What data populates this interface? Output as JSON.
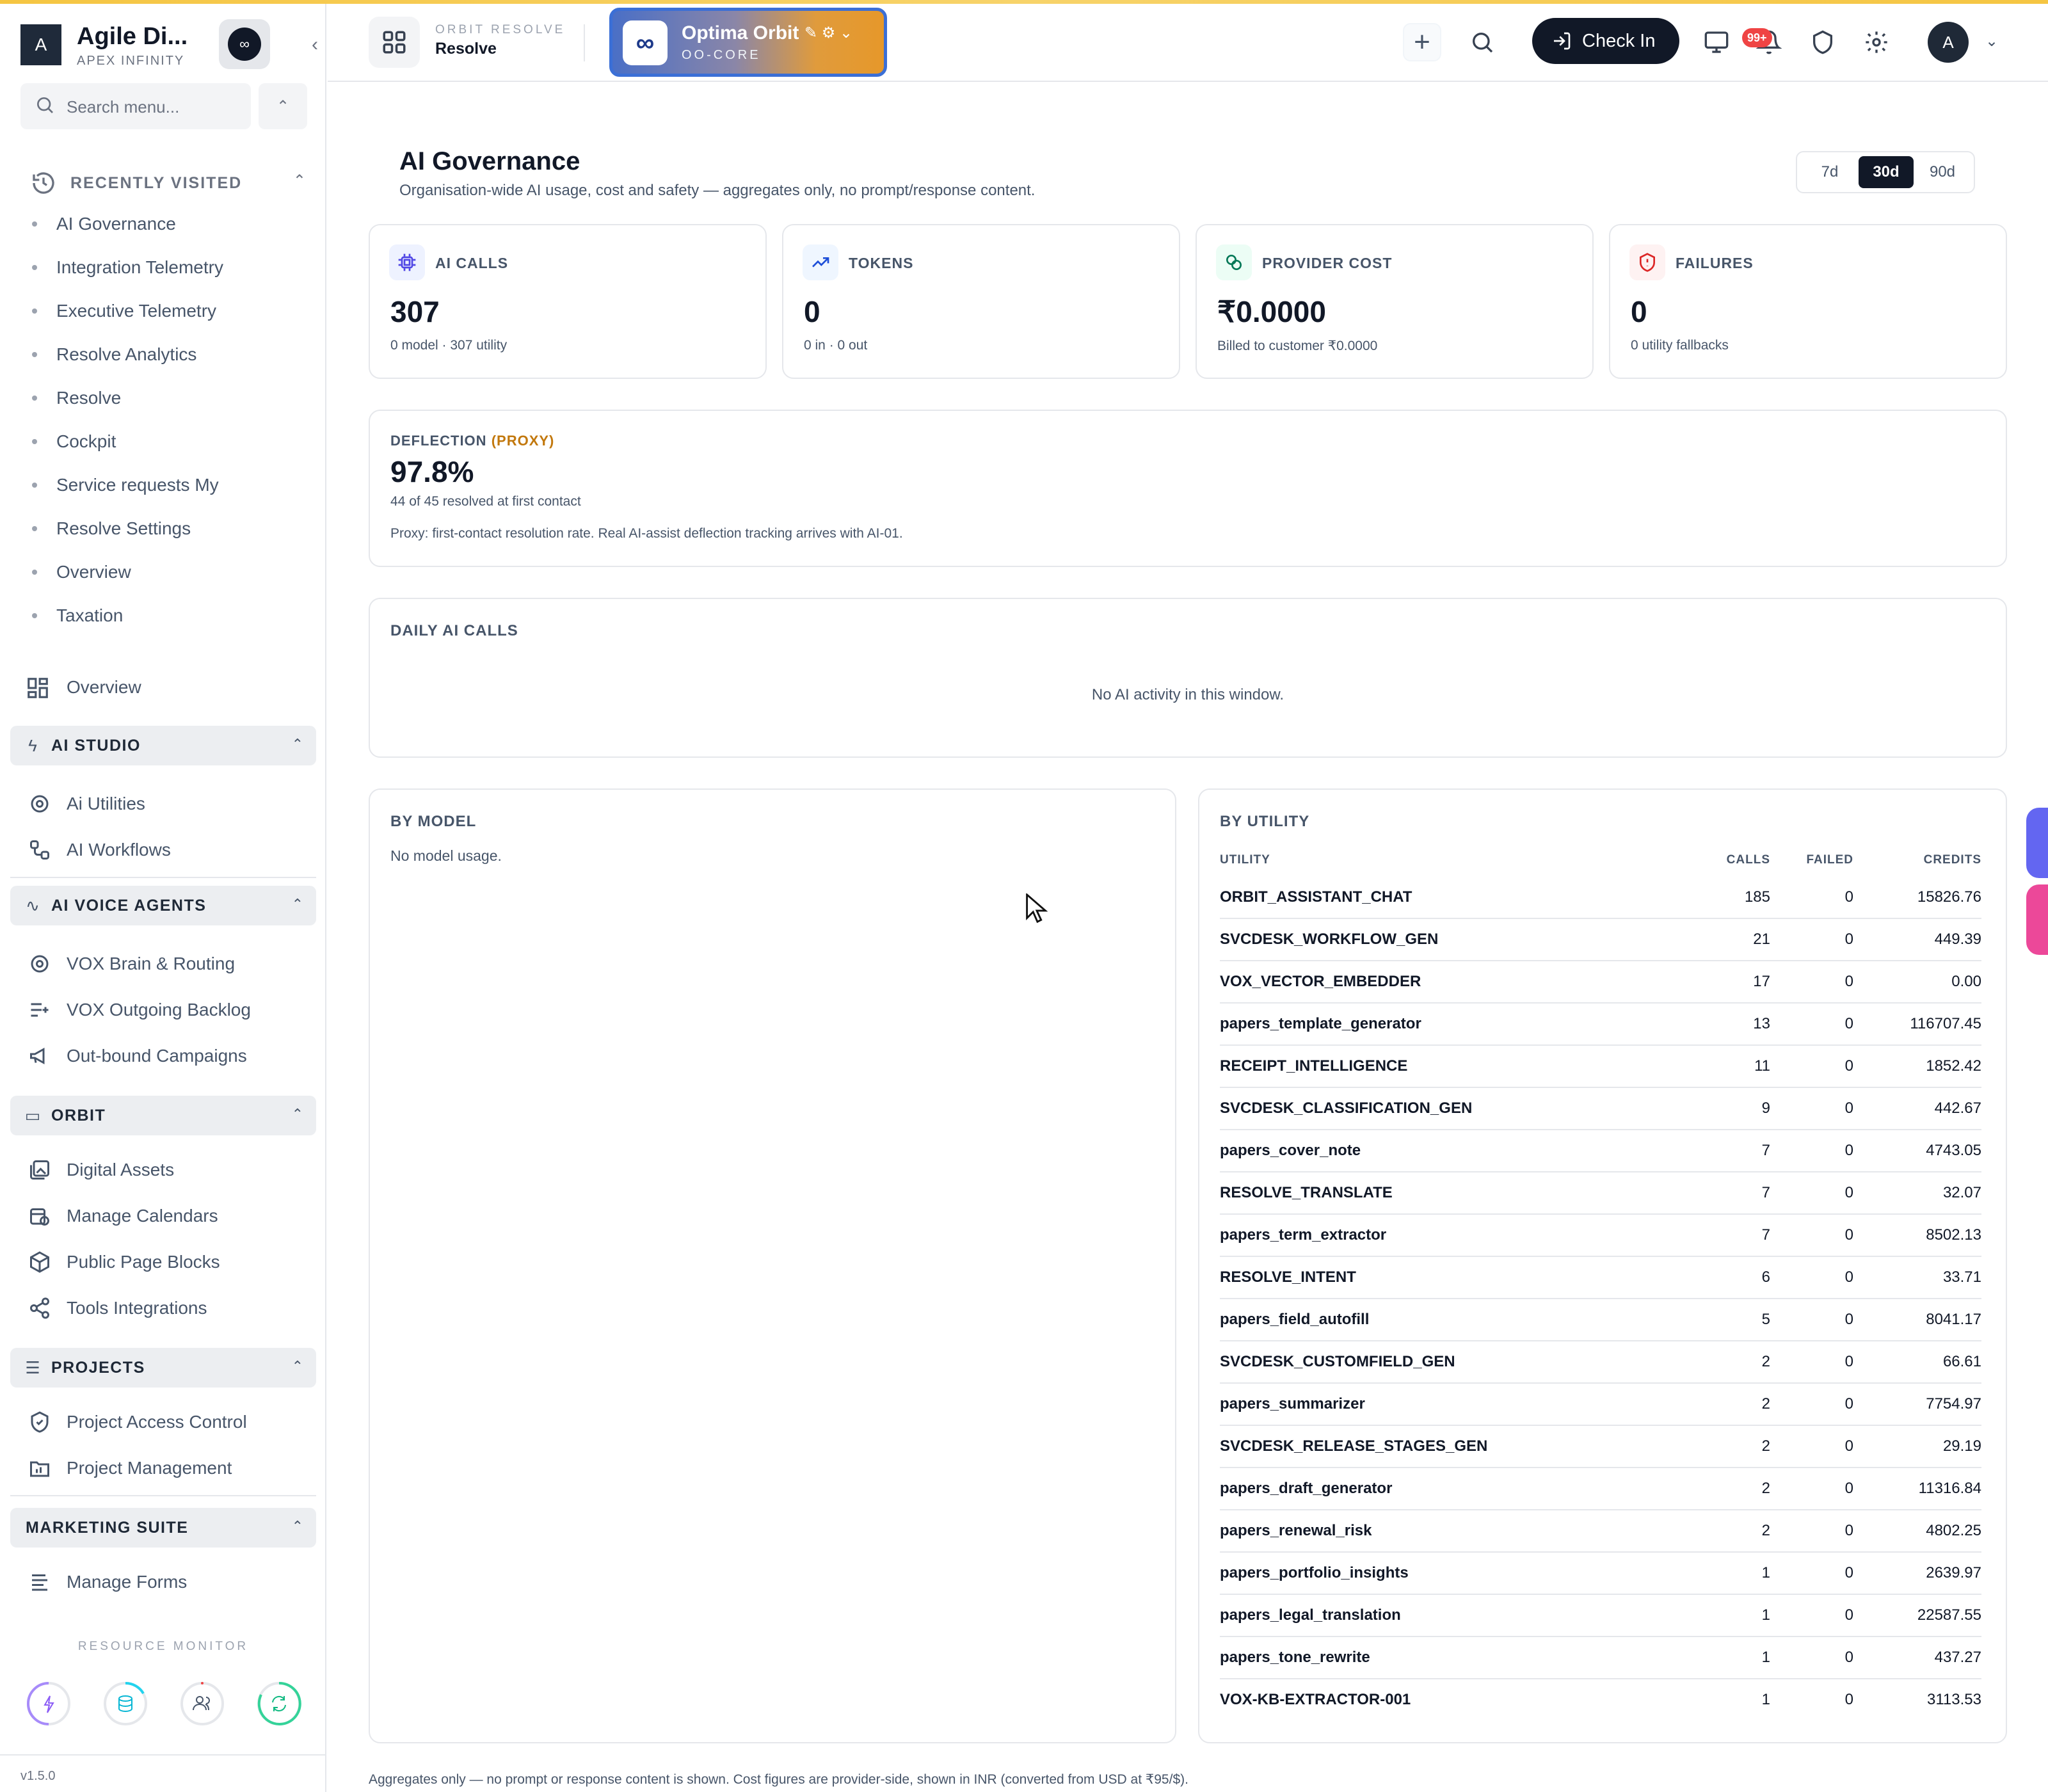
{
  "sidebar": {
    "brand": {
      "initial": "A",
      "name": "Agile Di...",
      "subtitle": "APEX INFINITY"
    },
    "search_placeholder": "Search menu...",
    "recently_visited": {
      "label": "RECENTLY VISITED",
      "items": [
        "AI Governance",
        "Integration Telemetry",
        "Executive Telemetry",
        "Resolve Analytics",
        "Resolve",
        "Cockpit",
        "Service requests My",
        "Resolve Settings",
        "Overview",
        "Taxation"
      ]
    },
    "overview_label": "Overview",
    "sections": [
      {
        "label": "AI STUDIO",
        "items": [
          "Ai Utilities",
          "AI Workflows"
        ]
      },
      {
        "label": "AI VOICE AGENTS",
        "items": [
          "VOX Brain & Routing",
          "VOX Outgoing Backlog",
          "Out-bound Campaigns"
        ]
      },
      {
        "label": "ORBIT",
        "items": [
          "Digital Assets",
          "Manage Calendars",
          "Public Page Blocks",
          "Tools Integrations"
        ]
      },
      {
        "label": "PROJECTS",
        "items": [
          "Project Access Control",
          "Project Management"
        ]
      },
      {
        "label": "MARKETING SUITE",
        "items": [
          "Manage Forms"
        ]
      }
    ],
    "resource_monitor_label": "RESOURCE MONITOR",
    "resource_icons": [
      "bolt-icon",
      "database-icon",
      "users-icon",
      "refresh-icon"
    ],
    "version": "v1.5.0"
  },
  "header": {
    "app_kicker": "ORBIT RESOLVE",
    "app_name": "Resolve",
    "org": {
      "name": "Optima Orbit",
      "code": "OO-CORE"
    },
    "check_in_label": "Check In",
    "notification_badge": "99+",
    "avatar_initial": "A"
  },
  "page": {
    "title": "AI Governance",
    "subtitle": "Organisation-wide AI usage, cost and safety — aggregates only, no prompt/response content.",
    "ranges": [
      "7d",
      "30d",
      "90d"
    ],
    "active_range": "30d"
  },
  "stats": [
    {
      "label": "AI CALLS",
      "value": "307",
      "sub": "0 model · 307 utility",
      "icon": "chip-icon",
      "color": "#eef2ff"
    },
    {
      "label": "TOKENS",
      "value": "0",
      "sub": "0 in · 0 out",
      "icon": "trending-up-icon",
      "color": "#eff6ff"
    },
    {
      "label": "PROVIDER COST",
      "value": "₹0.0000",
      "sub": "Billed to customer ₹0.0000",
      "icon": "coins-icon",
      "color": "#ecfdf5"
    },
    {
      "label": "FAILURES",
      "value": "0",
      "sub": "0 utility fallbacks",
      "icon": "shield-alert-icon",
      "color": "#fef2f2"
    }
  ],
  "deflection": {
    "label": "DEFLECTION",
    "proxy": "(PROXY)",
    "value": "97.8%",
    "sub": "44 of 45 resolved at first contact",
    "note": "Proxy: first-contact resolution rate. Real AI-assist deflection tracking arrives with AI-01."
  },
  "daily": {
    "label": "DAILY AI CALLS",
    "empty": "No AI activity in this window."
  },
  "by_model": {
    "label": "BY MODEL",
    "empty": "No model usage."
  },
  "by_utility": {
    "label": "BY UTILITY",
    "columns": {
      "utility": "UTILITY",
      "calls": "CALLS",
      "failed": "FAILED",
      "credits": "CREDITS"
    },
    "rows": [
      {
        "name": "ORBIT_ASSISTANT_CHAT",
        "calls": "185",
        "failed": "0",
        "credits": "15826.76"
      },
      {
        "name": "SVCDESK_WORKFLOW_GEN",
        "calls": "21",
        "failed": "0",
        "credits": "449.39"
      },
      {
        "name": "VOX_VECTOR_EMBEDDER",
        "calls": "17",
        "failed": "0",
        "credits": "0.00"
      },
      {
        "name": "papers_template_generator",
        "calls": "13",
        "failed": "0",
        "credits": "116707.45"
      },
      {
        "name": "RECEIPT_INTELLIGENCE",
        "calls": "11",
        "failed": "0",
        "credits": "1852.42"
      },
      {
        "name": "SVCDESK_CLASSIFICATION_GEN",
        "calls": "9",
        "failed": "0",
        "credits": "442.67"
      },
      {
        "name": "papers_cover_note",
        "calls": "7",
        "failed": "0",
        "credits": "4743.05"
      },
      {
        "name": "RESOLVE_TRANSLATE",
        "calls": "7",
        "failed": "0",
        "credits": "32.07"
      },
      {
        "name": "papers_term_extractor",
        "calls": "7",
        "failed": "0",
        "credits": "8502.13"
      },
      {
        "name": "RESOLVE_INTENT",
        "calls": "6",
        "failed": "0",
        "credits": "33.71"
      },
      {
        "name": "papers_field_autofill",
        "calls": "5",
        "failed": "0",
        "credits": "8041.17"
      },
      {
        "name": "SVCDESK_CUSTOMFIELD_GEN",
        "calls": "2",
        "failed": "0",
        "credits": "66.61"
      },
      {
        "name": "papers_summarizer",
        "calls": "2",
        "failed": "0",
        "credits": "7754.97"
      },
      {
        "name": "SVCDESK_RELEASE_STAGES_GEN",
        "calls": "2",
        "failed": "0",
        "credits": "29.19"
      },
      {
        "name": "papers_draft_generator",
        "calls": "2",
        "failed": "0",
        "credits": "11316.84"
      },
      {
        "name": "papers_renewal_risk",
        "calls": "2",
        "failed": "0",
        "credits": "4802.25"
      },
      {
        "name": "papers_portfolio_insights",
        "calls": "1",
        "failed": "0",
        "credits": "2639.97"
      },
      {
        "name": "papers_legal_translation",
        "calls": "1",
        "failed": "0",
        "credits": "22587.55"
      },
      {
        "name": "papers_tone_rewrite",
        "calls": "1",
        "failed": "0",
        "credits": "437.27"
      },
      {
        "name": "VOX-KB-EXTRACTOR-001",
        "calls": "1",
        "failed": "0",
        "credits": "3113.53"
      }
    ]
  },
  "footer_note": "Aggregates only — no prompt or response content is shown. Cost figures are provider-side, shown in INR (converted from USD at ₹95/$)."
}
